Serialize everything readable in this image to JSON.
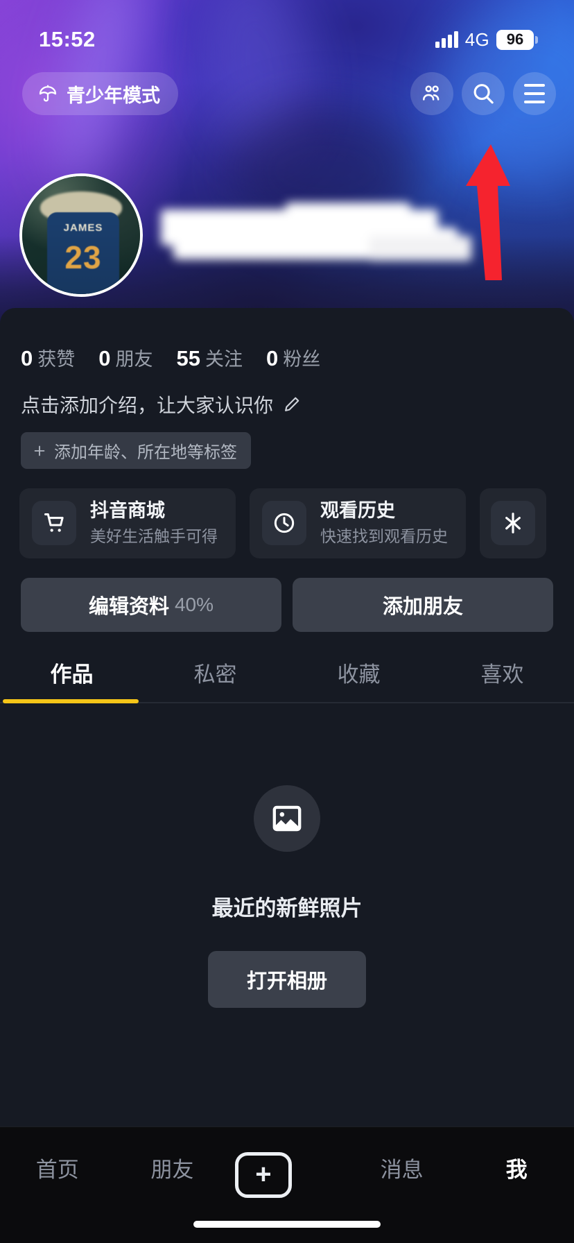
{
  "status_bar": {
    "time": "15:52",
    "network": "4G",
    "battery": "96",
    "signal_icon": "signal-bars-icon",
    "battery_icon": "battery-icon"
  },
  "header": {
    "teen_mode_label": "青少年模式",
    "teen_mode_icon": "umbrella-icon",
    "friends_icon": "people-icon",
    "search_icon": "search-icon",
    "menu_icon": "hamburger-menu-icon"
  },
  "annotation": {
    "arrow_color": "#f5232e",
    "arrow_icon": "red-arrow-up-icon",
    "points_to": "hamburger-menu-icon"
  },
  "profile": {
    "avatar_icon": "user-avatar-image",
    "avatar_jersey_name": "JAMES",
    "avatar_jersey_number": "23",
    "nickname_redacted": true,
    "stats": [
      {
        "value": "0",
        "label": "获赞"
      },
      {
        "value": "0",
        "label": "朋友"
      },
      {
        "value": "55",
        "label": "关注"
      },
      {
        "value": "0",
        "label": "粉丝"
      }
    ],
    "bio_placeholder": "点击添加介绍，让大家认识你",
    "bio_edit_icon": "pencil-icon",
    "add_tag_label": "添加年龄、所在地等标签",
    "add_tag_icon": "plus-icon"
  },
  "cards": [
    {
      "title": "抖音商城",
      "subtitle": "美好生活触手可得",
      "icon": "shopping-cart-icon"
    },
    {
      "title": "观看历史",
      "subtitle": "快速找到观看历史",
      "icon": "clock-icon"
    },
    {
      "title": "",
      "subtitle": "",
      "icon": "sparkle-icon"
    }
  ],
  "actions": {
    "edit_profile_label": "编辑资料",
    "edit_profile_percent": "40%",
    "add_friend_label": "添加朋友"
  },
  "tabs": {
    "active_index": 0,
    "accent_color": "#f5c518",
    "items": [
      {
        "label": "作品"
      },
      {
        "label": "私密"
      },
      {
        "label": "收藏"
      },
      {
        "label": "喜欢"
      }
    ]
  },
  "empty_state": {
    "icon": "photo-image-icon",
    "title": "最近的新鲜照片",
    "button_label": "打开相册"
  },
  "bottom_nav": {
    "active_index": 4,
    "items": [
      {
        "label": "首页"
      },
      {
        "label": "朋友"
      },
      {
        "label": "",
        "icon": "plus-create-icon"
      },
      {
        "label": "消息"
      },
      {
        "label": "我"
      }
    ]
  }
}
